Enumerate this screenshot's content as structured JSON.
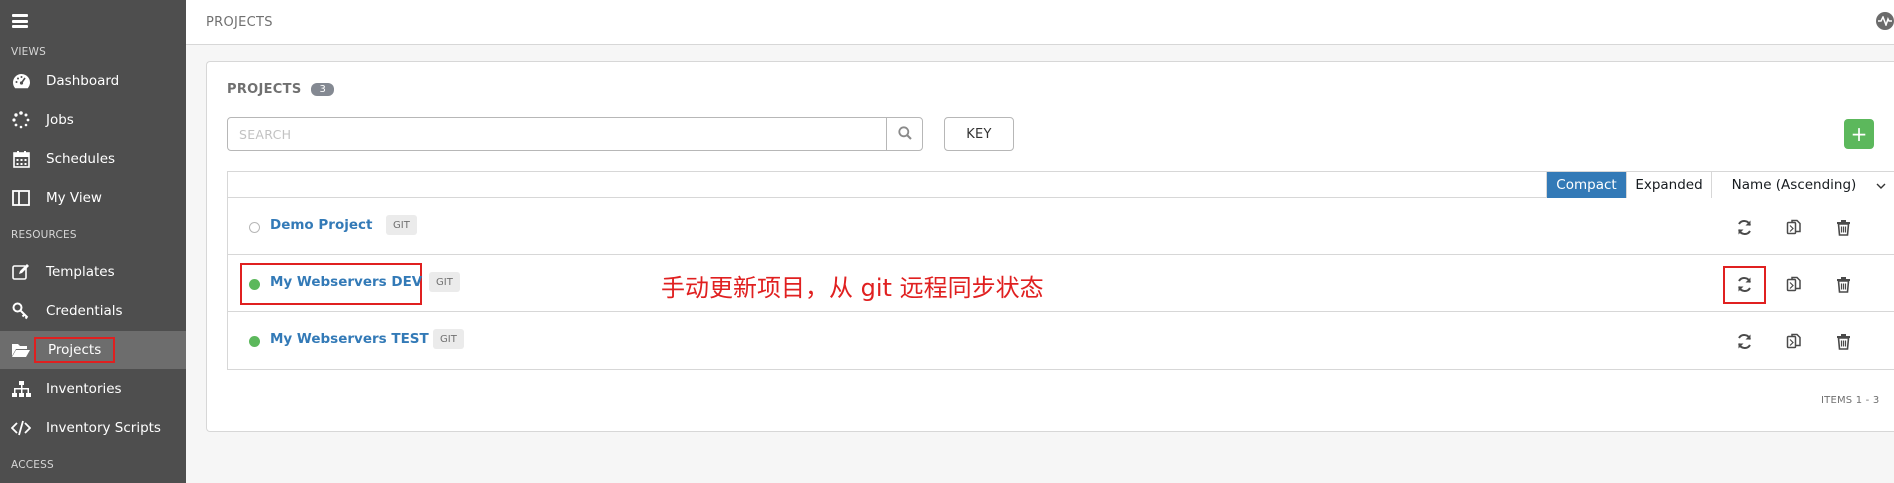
{
  "sidebar": {
    "views_label": "VIEWS",
    "resources_label": "RESOURCES",
    "access_label": "ACCESS",
    "items": [
      {
        "label": "Dashboard",
        "icon": "dashboard-icon"
      },
      {
        "label": "Jobs",
        "icon": "spinner-icon"
      },
      {
        "label": "Schedules",
        "icon": "calendar-icon"
      },
      {
        "label": "My View",
        "icon": "columns-icon"
      },
      {
        "label": "Templates",
        "icon": "pencil-square-icon"
      },
      {
        "label": "Credentials",
        "icon": "key-icon"
      },
      {
        "label": "Projects",
        "icon": "folder-open-icon",
        "active": true
      },
      {
        "label": "Inventories",
        "icon": "sitemap-icon"
      },
      {
        "label": "Inventory Scripts",
        "icon": "code-icon"
      }
    ]
  },
  "header": {
    "breadcrumb": "PROJECTS"
  },
  "panel": {
    "title": "PROJECTS",
    "count": "3",
    "search_placeholder": "SEARCH",
    "key_label": "KEY",
    "add_label": "+"
  },
  "toolbar": {
    "compact_label": "Compact",
    "expanded_label": "Expanded",
    "sort_label": "Name (Ascending)"
  },
  "projects": [
    {
      "name": "Demo Project",
      "scm": "GIT",
      "status": "never-updated"
    },
    {
      "name": "My Webservers DEV",
      "scm": "GIT",
      "status": "successful"
    },
    {
      "name": "My Webservers TEST",
      "scm": "GIT",
      "status": "successful"
    }
  ],
  "annotation": "手动更新项目，从 git 远程同步状态",
  "pagination": {
    "items_label": "ITEMS  1 - 3"
  },
  "colors": {
    "sidebar": "#4e4e4e",
    "link": "#337ab7",
    "success": "#5cb85c",
    "annotation": "#e02020"
  }
}
